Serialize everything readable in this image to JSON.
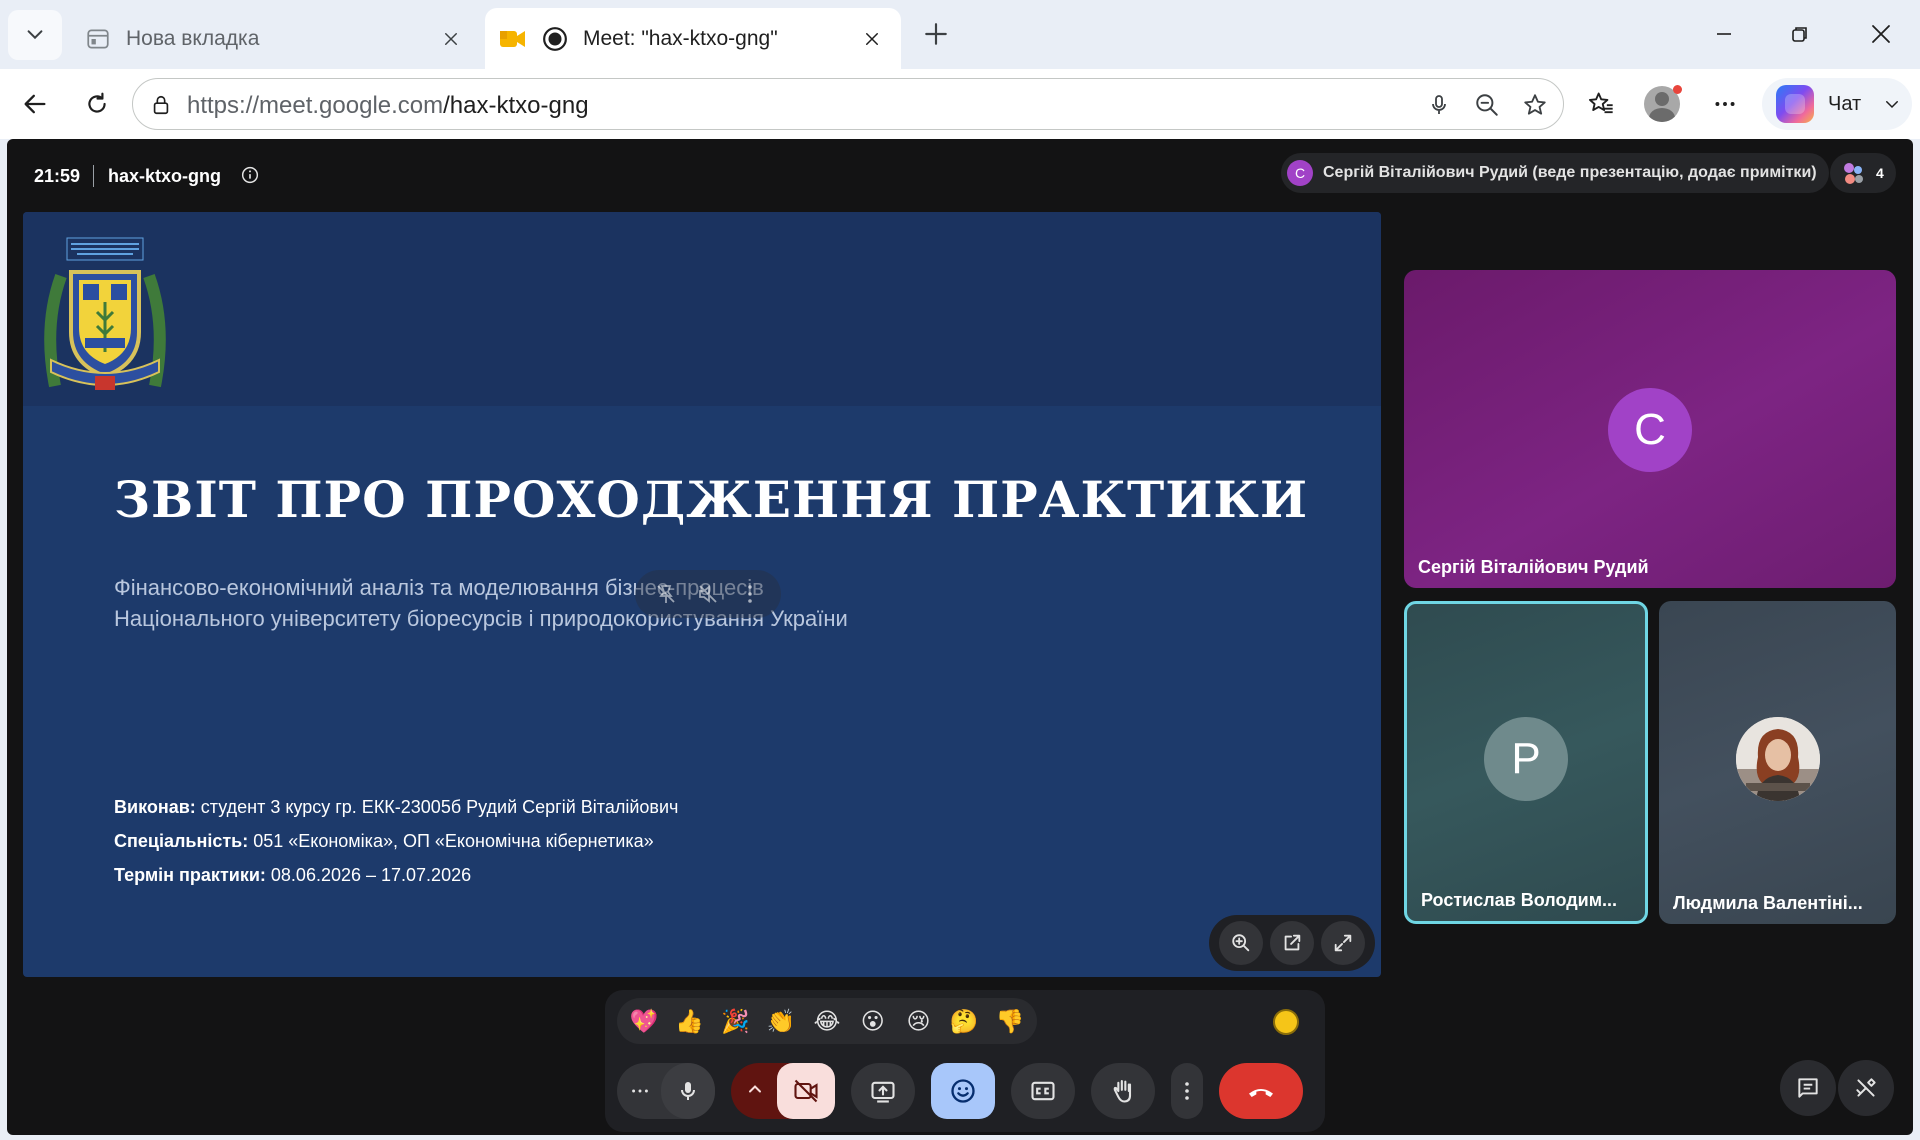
{
  "browser": {
    "tabs": [
      {
        "title": "Нова вкладка",
        "active": false
      },
      {
        "title": "Meet: \"hax-ktxo-gng\"",
        "active": true
      }
    ],
    "url_host": "https://meet.google.com",
    "url_path": "/hax-ktxo-gng",
    "chat_label": "Чат"
  },
  "meet": {
    "time": "21:59",
    "meeting_code": "hax-ktxo-gng",
    "presenter_initial": "C",
    "presenter_text": "Сергій Віталійович Рудий (веде презентацію, додає примітки)",
    "participant_count": "4",
    "slide": {
      "title": "ЗВІТ ПРО ПРОХОДЖЕННЯ ПРАКТИКИ",
      "subtitle_line1": "Фінансово-економічний аналіз та моделювання бізнес-процесів",
      "subtitle_line2": "Національного університету біоресурсів і природокористування України",
      "performer_label": "Виконав:",
      "performer_value": " студент 3 курсу гр. ЕКК-23005б Рудий Сергій Віталійович",
      "specialty_label": "Спеціальність:",
      "specialty_value": " 051 «Економіка», ОП «Економічна кібернетика»",
      "term_label": "Термін практики:",
      "term_value": " 08.06.2026 – 17.07.2026"
    },
    "tiles": [
      {
        "initial": "C",
        "name": "Сергій Віталійович Рудий",
        "avatar_color": "#a142c7"
      },
      {
        "initial": "P",
        "name": "Ростислав Володим...",
        "avatar_color": "#6f8a8c"
      },
      {
        "initial": "",
        "name": "Людмила Валентіні...",
        "avatar_color": "#d9d3cc"
      }
    ],
    "reactions": [
      "💖",
      "👍",
      "🎉",
      "👏",
      "😂",
      "😮",
      "😢",
      "🤔",
      "👎"
    ],
    "colors": {
      "end_call": "#dc362e",
      "camera_off_bg": "#f9dedc",
      "emoji_active_bg": "#a8c7fa",
      "active_speaker_border": "#6fd6e4"
    }
  }
}
